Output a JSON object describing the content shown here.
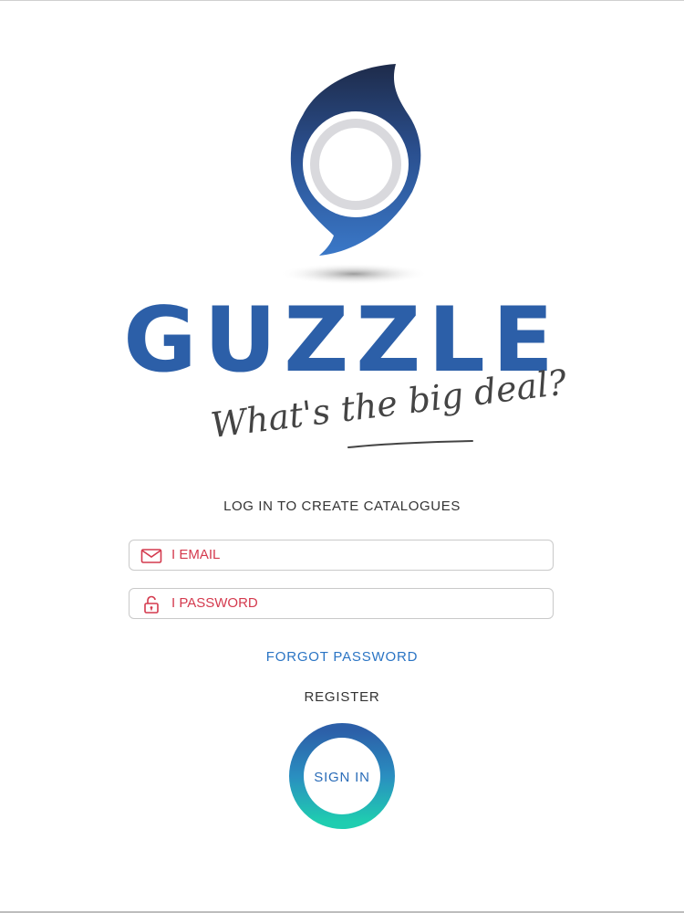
{
  "brand": {
    "name": "GUZZLE",
    "tagline": "What's the big deal?",
    "color": "#2c5fa8"
  },
  "login": {
    "heading": "LOG IN TO CREATE CATALOGUES",
    "email": {
      "placeholder": "I EMAIL",
      "value": "",
      "icon": "envelope-icon"
    },
    "password": {
      "placeholder": "I PASSWORD",
      "value": "",
      "icon": "padlock-icon"
    },
    "forgot_label": "FORGOT PASSWORD",
    "register_label": "REGISTER",
    "signin_label": "SIGN IN"
  },
  "colors": {
    "accent_blue": "#2a74c4",
    "field_text": "#d43a4e",
    "ring_start": "#2c5fa8",
    "ring_end": "#1fcdb0"
  }
}
